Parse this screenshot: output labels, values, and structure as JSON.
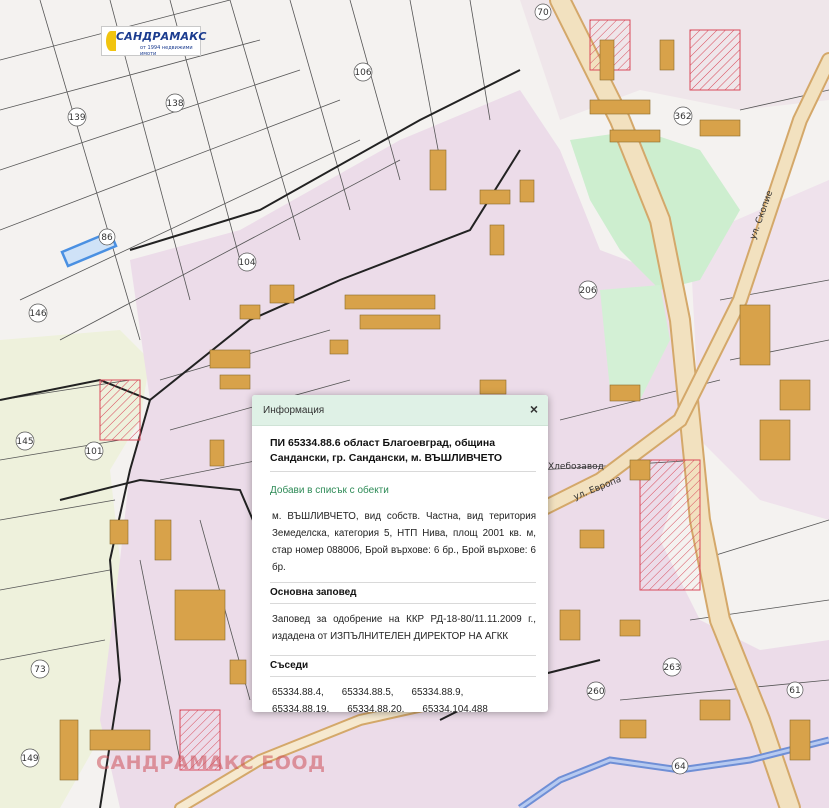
{
  "logo": {
    "name": "САНДРАМАКС",
    "tagline": "от 1994 недвижими имоти"
  },
  "watermark": "САНДРАМАКС ЕООД",
  "map_labels": {
    "parcels": [
      "139",
      "138",
      "106",
      "86",
      "104",
      "146",
      "145",
      "101",
      "73",
      "149",
      "70",
      "362",
      "206",
      "260",
      "263",
      "61",
      "64"
    ],
    "streets": [
      "ул. Скопие",
      "ул. Европа",
      "Хлебозавод"
    ]
  },
  "popup": {
    "header_title": "Информация",
    "close_label": "×",
    "parcel_title": "ПИ 65334.88.6 област Благоевград, община Сандански, гр. Сандански, м. ВЪШЛИВЧЕТО",
    "add_link": "Добави в списък с обекти",
    "description": "м. ВЪШЛИВЧЕТО, вид собств. Частна, вид територия Земеделска, категория 5, НТП Нива, площ 2001 кв. м, стар номер 088006, Брой върхове: 6 бр., Брой върхове: 6 бр.",
    "order_heading": "Основна заповед",
    "order_text": "Заповед за одобрение на ККР РД-18-80/11.11.2009 г., издадена от ИЗПЪЛНИТЕЛЕН ДИРЕКТОР НА АГКК",
    "neighbors_heading": "Съседи",
    "neighbors": [
      "65334.88.4,",
      "65334.88.5,",
      "65334.88.9,",
      "65334.88.19,",
      "65334.88.20,",
      "65334.104.488"
    ]
  },
  "colors": {
    "urban_zone": "#ecdce9",
    "park": "#cdeecf",
    "agricultural": "#eef1dc",
    "building": "#d8a24a",
    "road_main": "#f2e1bf",
    "river": "#6f8fd6",
    "selected_parcel": "#4a90e2",
    "header_bg": "#dff1e6",
    "link": "#2e8b57"
  }
}
